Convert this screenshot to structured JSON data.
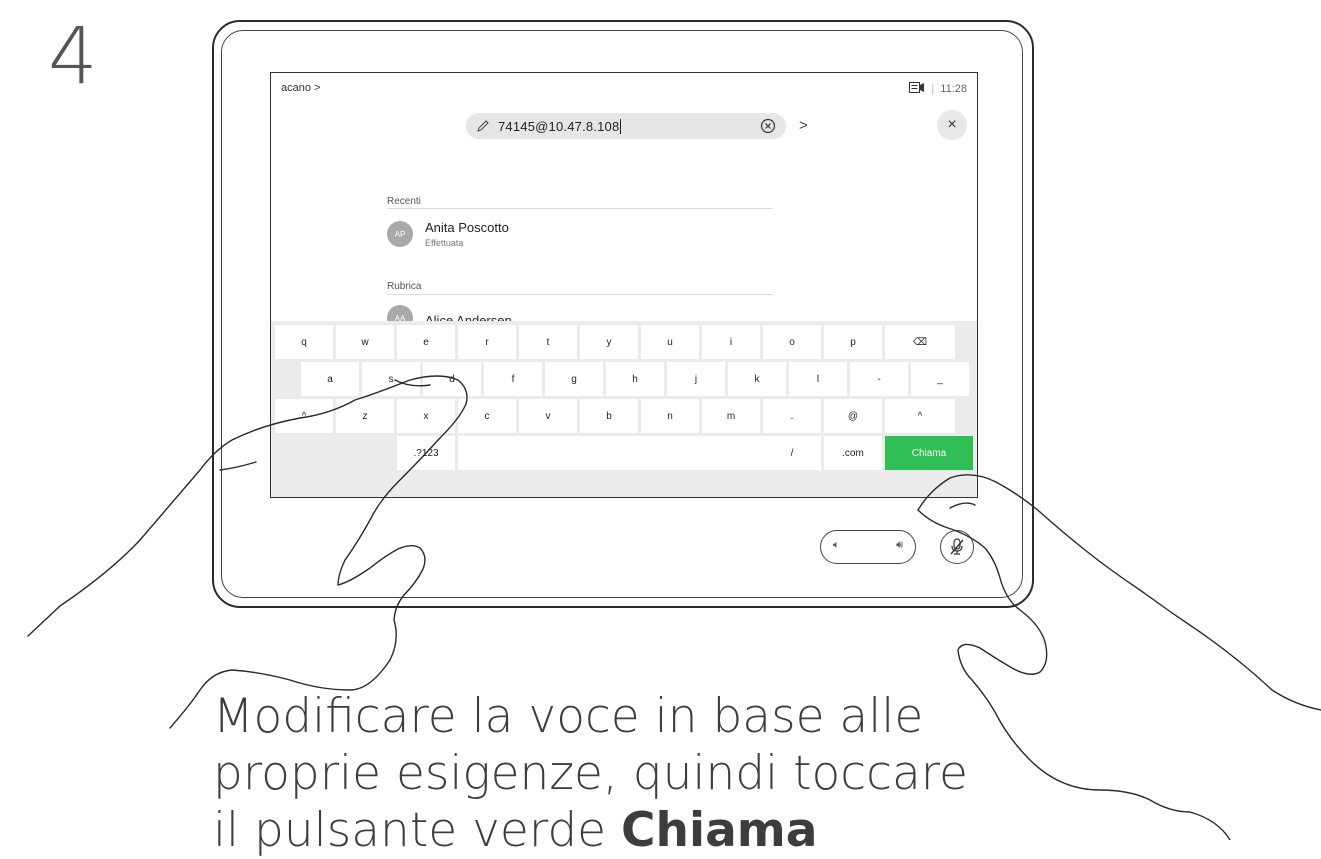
{
  "step_number": "4",
  "screen": {
    "breadcrumb": "acano >",
    "status_time": "11:28",
    "status_separator": "|",
    "search_value": "74145@10.47.8.108",
    "go_arrow": ">",
    "close_label": "×",
    "sections": {
      "recent_label": "Recenti",
      "directory_label": "Rubrica"
    },
    "recent_contact": {
      "initials": "AP",
      "name": "Anita Poscotto",
      "status": "Effettuata"
    },
    "directory_contact_partial": {
      "initials": "AA",
      "name": "Alice Andersen"
    }
  },
  "keyboard": {
    "row1": [
      "q",
      "w",
      "e",
      "r",
      "t",
      "y",
      "u",
      "i",
      "o",
      "p",
      "⌫"
    ],
    "row2": [
      "a",
      "s",
      "d",
      "f",
      "g",
      "h",
      "j",
      "k",
      "l",
      "-",
      "_"
    ],
    "row3": [
      "^",
      "z",
      "x",
      "c",
      "v",
      "b",
      "n",
      "m",
      ".",
      "@",
      "^"
    ],
    "row4": {
      "symbols": ".?123",
      "slash": "/",
      "dotcom": ".com",
      "call": "Chiama"
    },
    "call_color": "#2fbf55"
  },
  "controls": {
    "volume_down_icon": "volume-down-icon",
    "volume_up_icon": "volume-up-icon",
    "mute_icon": "microphone-mute-icon"
  },
  "caption": {
    "line1": "Modificare la voce in base alle",
    "line2": "proprie esigenze, quindi toccare",
    "line3_prefix": "il pulsante verde ",
    "line3_bold": "Chiama"
  }
}
